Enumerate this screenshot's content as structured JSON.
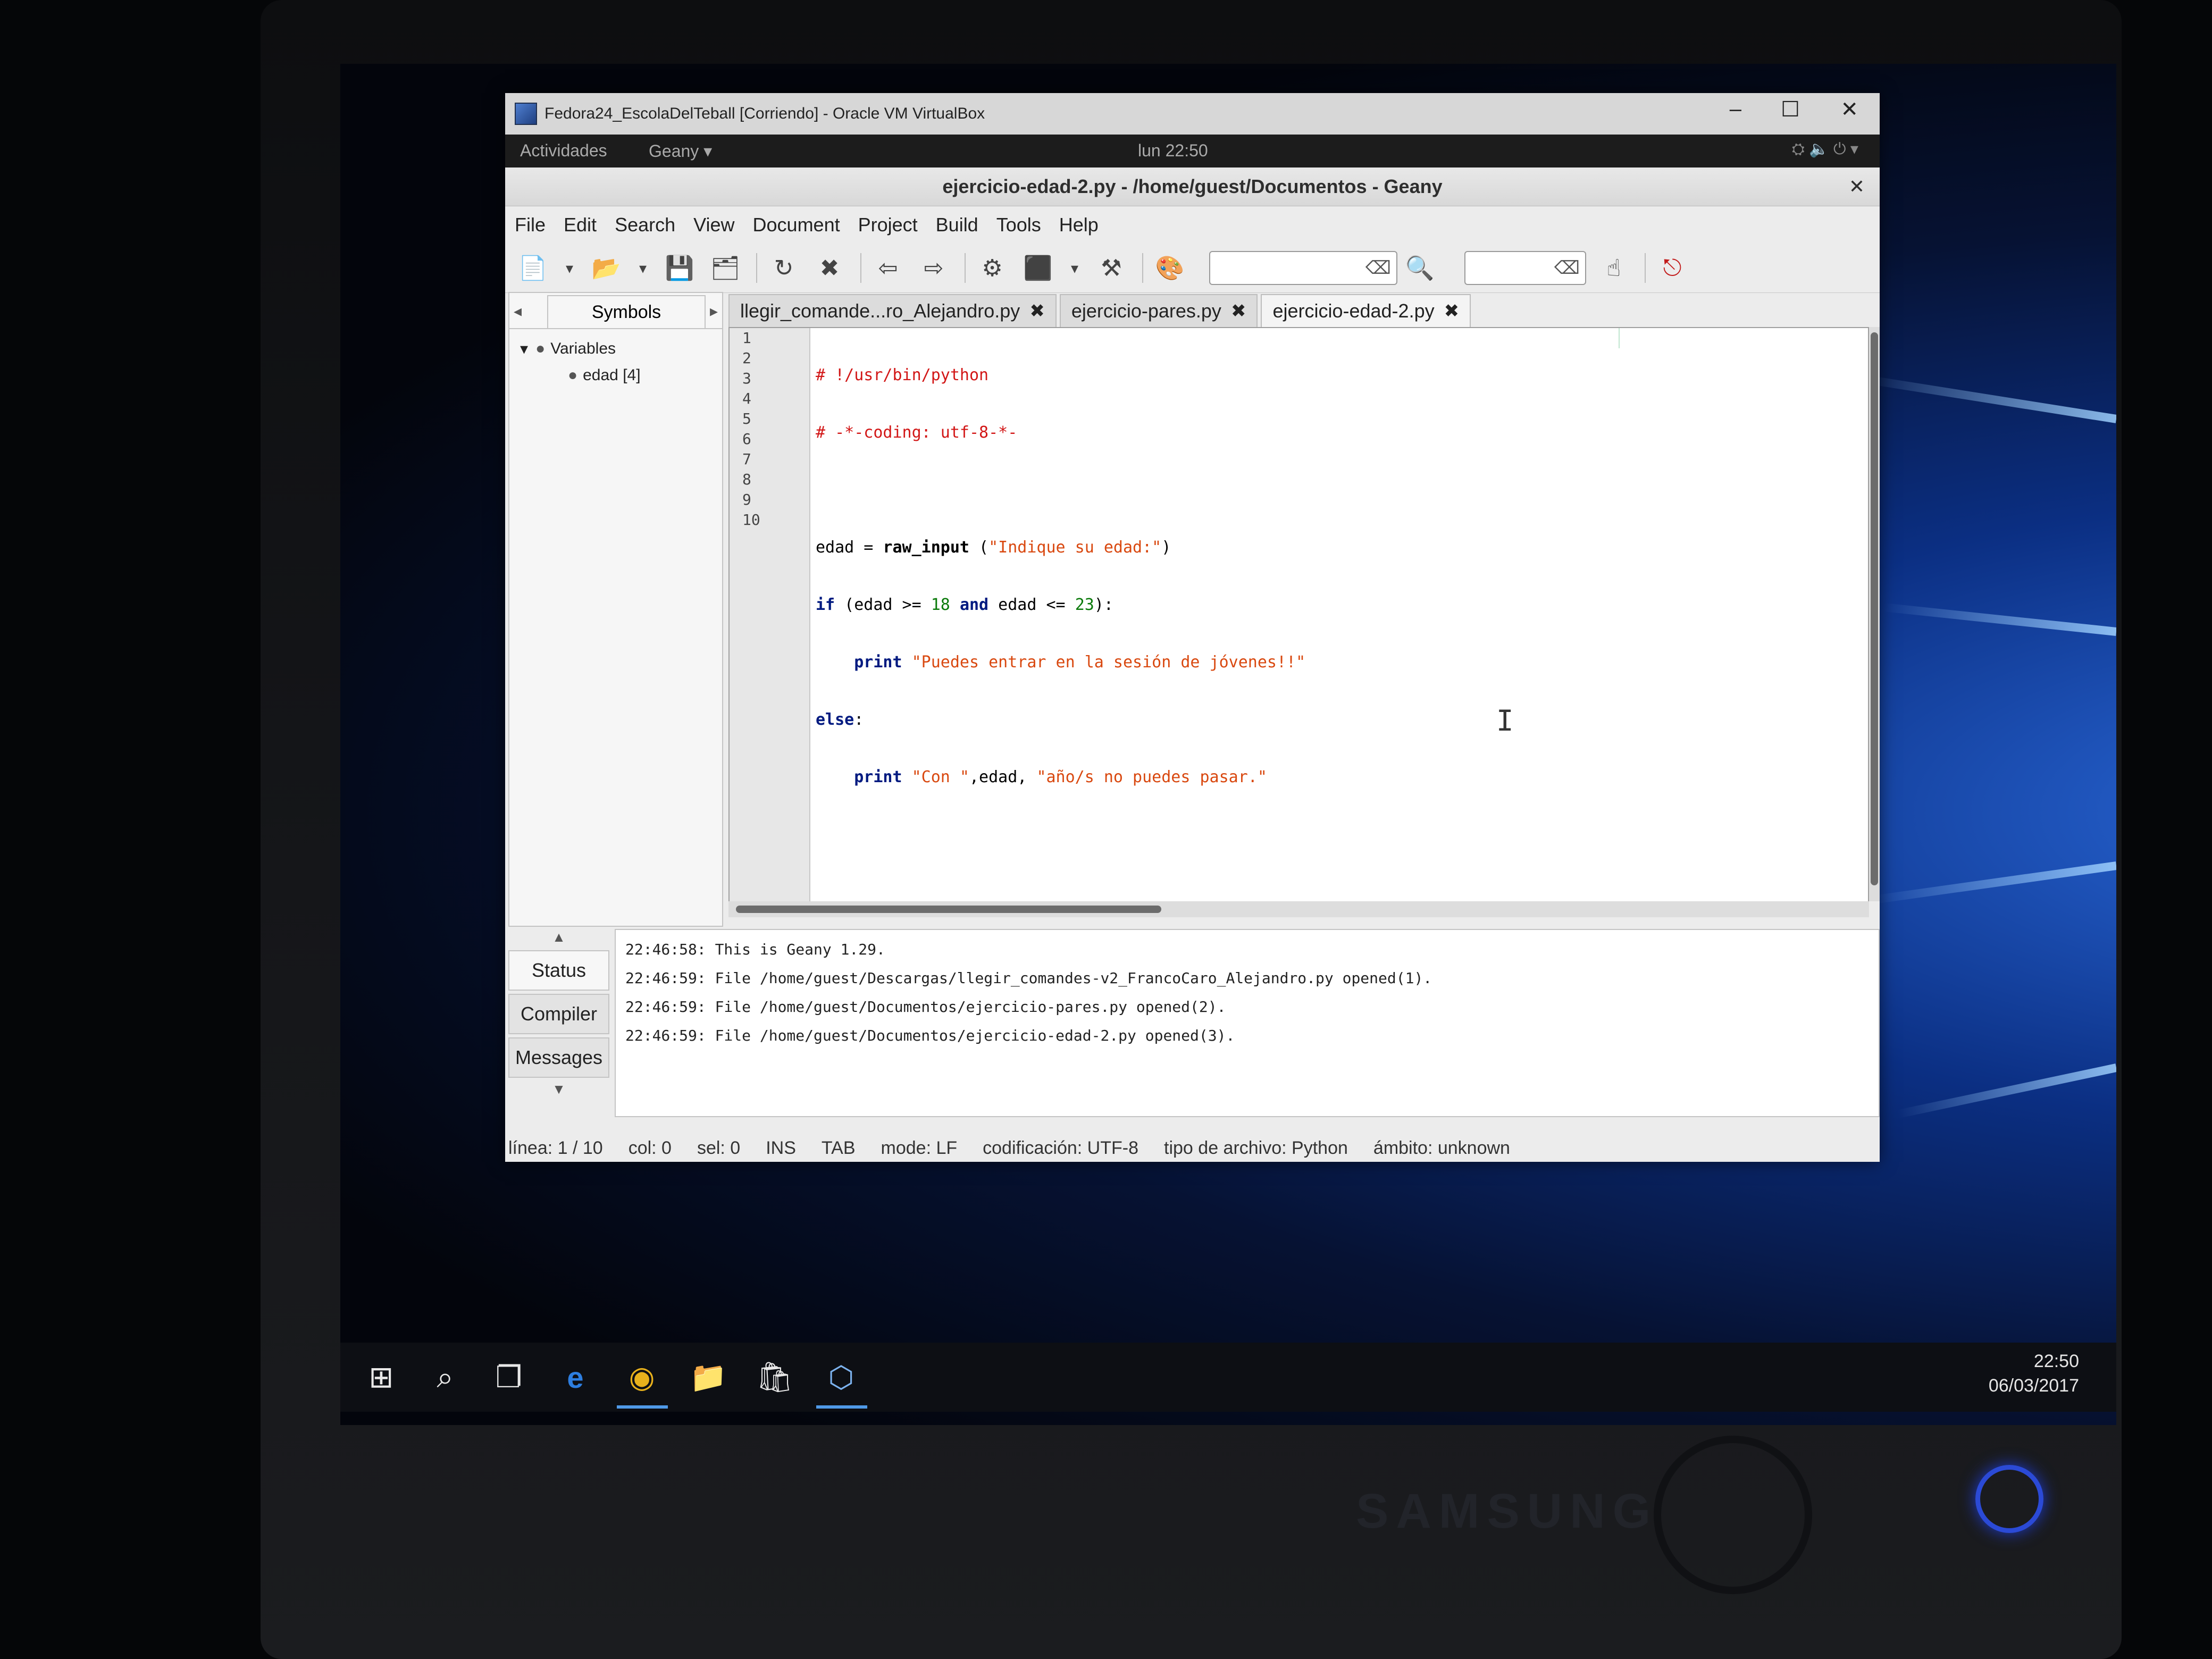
{
  "virtualbox": {
    "title": "Fedora24_EscolaDelTeball [Corriendo] - Oracle VM VirtualBox",
    "minimize": "–",
    "maximize": "☐",
    "close": "✕"
  },
  "gnome": {
    "activities": "Actividades",
    "app_menu": "Geany ▾",
    "clock": "lun 22:50"
  },
  "geany": {
    "window_title": "ejercicio-edad-2.py - /home/guest/Documentos - Geany",
    "close": "✕",
    "menu": [
      "File",
      "Edit",
      "Search",
      "View",
      "Document",
      "Project",
      "Build",
      "Tools",
      "Help"
    ],
    "search_placeholder": "",
    "sidebar": {
      "tab": "Symbols",
      "tree": [
        {
          "label": "Variables"
        },
        {
          "label": "edad [4]"
        }
      ]
    },
    "tabs": [
      {
        "label": "llegir_comande...ro_Alejandro.py",
        "close": "✖"
      },
      {
        "label": "ejercicio-pares.py",
        "close": "✖"
      },
      {
        "label": "ejercicio-edad-2.py",
        "close": "✖"
      }
    ],
    "line_numbers": [
      "1",
      "2",
      "3",
      "4",
      "5",
      "6",
      "7",
      "8",
      "9",
      "10"
    ],
    "code": {
      "l1": "# !/usr/bin/python",
      "l2": "# -*-coding: utf-8-*-",
      "l4_a": "edad = ",
      "l4_fn": "raw_input",
      "l4_b": " (",
      "l4_str": "\"Indique su edad:\"",
      "l4_c": ")",
      "l5_kw": "if",
      "l5_a": " (edad >= ",
      "l5_num": "18",
      "l5_kw2": "and",
      "l5_b": " edad <= ",
      "l5_num2": "23",
      "l5_c": "):",
      "l6_kw": "print",
      "l6_str": "\"Puedes entrar en la sesión de jóvenes!!\"",
      "l7_kw": "else",
      "l7_c": ":",
      "l8_kw": "print",
      "l8_str1": "\"Con \"",
      "l8_a": ",edad, ",
      "l8_str2": "\"año/s no puedes pasar.\""
    },
    "message_tabs": [
      "Status",
      "Compiler",
      "Messages"
    ],
    "log": [
      "22:46:58: This is Geany 1.29.",
      "22:46:59: File /home/guest/Descargas/llegir_comandes-v2_FrancoCaro_Alejandro.py opened(1).",
      "22:46:59: File /home/guest/Documentos/ejercicio-pares.py opened(2).",
      "22:46:59: File /home/guest/Documentos/ejercicio-edad-2.py opened(3)."
    ],
    "status": {
      "line": "línea: 1 / 10",
      "col": "col: 0",
      "sel": "sel: 0",
      "ins": "INS",
      "tab": "TAB",
      "mode": "mode: LF",
      "encoding": "codificación: UTF-8",
      "filetype": "tipo de archivo: Python",
      "scope": "ámbito: unknown"
    }
  },
  "taskbar": {
    "time": "22:50",
    "date": "06/03/2017"
  },
  "monitor": {
    "brand": "SAMSUNG"
  },
  "colors": {
    "accent": "#4f9ae8",
    "comment": "#d21616",
    "keyword": "#001a80",
    "string": "#d9480f"
  }
}
